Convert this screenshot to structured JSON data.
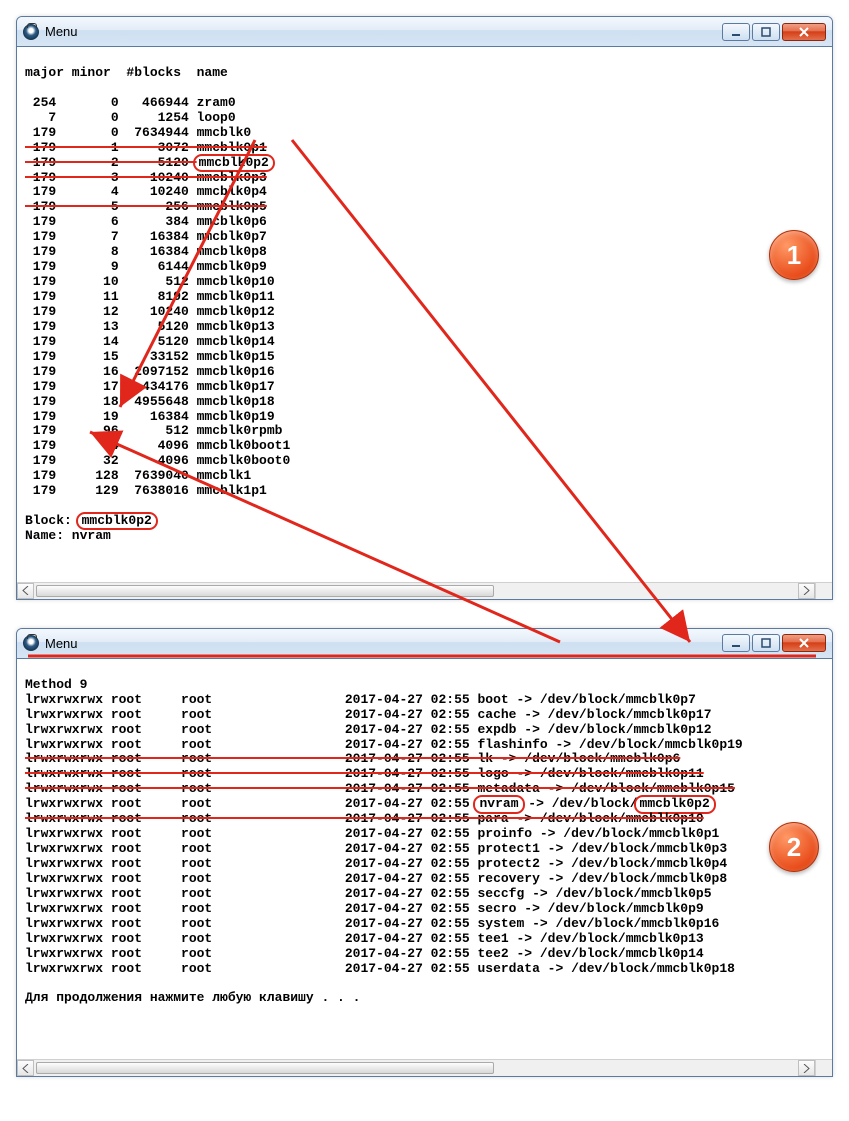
{
  "window1": {
    "title": "Menu",
    "header": "major minor  #blocks  name",
    "rows": [
      {
        "major": "254",
        "minor": "0",
        "blocks": "466944",
        "name": "zram0"
      },
      {
        "major": "7",
        "minor": "0",
        "blocks": "1254",
        "name": "loop0"
      },
      {
        "major": "179",
        "minor": "0",
        "blocks": "7634944",
        "name": "mmcblk0"
      },
      {
        "major": "179",
        "minor": "1",
        "blocks": "3072",
        "name": "mmcblk0p1",
        "strike": true
      },
      {
        "major": "179",
        "minor": "2",
        "blocks": "5120",
        "name": "mmcblk0p2",
        "highlight": true,
        "strike_prefix": true
      },
      {
        "major": "179",
        "minor": "3",
        "blocks": "10240",
        "name": "mmcblk0p3",
        "strike": true
      },
      {
        "major": "179",
        "minor": "4",
        "blocks": "10240",
        "name": "mmcblk0p4"
      },
      {
        "major": "179",
        "minor": "5",
        "blocks": "256",
        "name": "mmcblk0p5",
        "strike": true
      },
      {
        "major": "179",
        "minor": "6",
        "blocks": "384",
        "name": "mmcblk0p6"
      },
      {
        "major": "179",
        "minor": "7",
        "blocks": "16384",
        "name": "mmcblk0p7"
      },
      {
        "major": "179",
        "minor": "8",
        "blocks": "16384",
        "name": "mmcblk0p8"
      },
      {
        "major": "179",
        "minor": "9",
        "blocks": "6144",
        "name": "mmcblk0p9"
      },
      {
        "major": "179",
        "minor": "10",
        "blocks": "512",
        "name": "mmcblk0p10"
      },
      {
        "major": "179",
        "minor": "11",
        "blocks": "8192",
        "name": "mmcblk0p11"
      },
      {
        "major": "179",
        "minor": "12",
        "blocks": "10240",
        "name": "mmcblk0p12"
      },
      {
        "major": "179",
        "minor": "13",
        "blocks": "5120",
        "name": "mmcblk0p13"
      },
      {
        "major": "179",
        "minor": "14",
        "blocks": "5120",
        "name": "mmcblk0p14"
      },
      {
        "major": "179",
        "minor": "15",
        "blocks": "33152",
        "name": "mmcblk0p15"
      },
      {
        "major": "179",
        "minor": "16",
        "blocks": "2097152",
        "name": "mmcblk0p16"
      },
      {
        "major": "179",
        "minor": "17",
        "blocks": "434176",
        "name": "mmcblk0p17"
      },
      {
        "major": "179",
        "minor": "18",
        "blocks": "4955648",
        "name": "mmcblk0p18"
      },
      {
        "major": "179",
        "minor": "19",
        "blocks": "16384",
        "name": "mmcblk0p19"
      },
      {
        "major": "179",
        "minor": "96",
        "blocks": "512",
        "name": "mmcblk0rpmb"
      },
      {
        "major": "179",
        "minor": "64",
        "blocks": "4096",
        "name": "mmcblk0boot1"
      },
      {
        "major": "179",
        "minor": "32",
        "blocks": "4096",
        "name": "mmcblk0boot0"
      },
      {
        "major": "179",
        "minor": "128",
        "blocks": "7639040",
        "name": "mmcblk1"
      },
      {
        "major": "179",
        "minor": "129",
        "blocks": "7638016",
        "name": "mmcblk1p1"
      }
    ],
    "block_label": "Block:",
    "block_value": "mmcblk0p2",
    "name_label": "Name: nvram"
  },
  "window2": {
    "title": "Menu",
    "method": "Method 9",
    "listing": [
      {
        "perm": "lrwxrwxrwx",
        "u": "root",
        "g": "root",
        "date": "2017-04-27 02:55",
        "name": "boot",
        "target": "/dev/block/mmcblk0p7"
      },
      {
        "perm": "lrwxrwxrwx",
        "u": "root",
        "g": "root",
        "date": "2017-04-27 02:55",
        "name": "cache",
        "target": "/dev/block/mmcblk0p17"
      },
      {
        "perm": "lrwxrwxrwx",
        "u": "root",
        "g": "root",
        "date": "2017-04-27 02:55",
        "name": "expdb",
        "target": "/dev/block/mmcblk0p12"
      },
      {
        "perm": "lrwxrwxrwx",
        "u": "root",
        "g": "root",
        "date": "2017-04-27 02:55",
        "name": "flashinfo",
        "target": "/dev/block/mmcblk0p19"
      },
      {
        "perm": "lrwxrwxrwx",
        "u": "root",
        "g": "root",
        "date": "2017-04-27 02:55",
        "name": "lk",
        "target": "/dev/block/mmcblk0p6",
        "strike": true
      },
      {
        "perm": "lrwxrwxrwx",
        "u": "root",
        "g": "root",
        "date": "2017-04-27 02:55",
        "name": "logo",
        "target": "/dev/block/mmcblk0p11",
        "strike": true
      },
      {
        "perm": "lrwxrwxrwx",
        "u": "root",
        "g": "root",
        "date": "2017-04-27 02:55",
        "name": "metadata",
        "target": "/dev/block/mmcblk0p15",
        "strike": true
      },
      {
        "perm": "lrwxrwxrwx",
        "u": "root",
        "g": "root",
        "date": "2017-04-27 02:55",
        "name": "nvram",
        "target": "/dev/block/",
        "target2": "mmcblk0p2",
        "pill": true
      },
      {
        "perm": "lrwxrwxrwx",
        "u": "root",
        "g": "root",
        "date": "2017-04-27 02:55",
        "name": "para",
        "target": "/dev/block/mmcblk0p10",
        "strike": true
      },
      {
        "perm": "lrwxrwxrwx",
        "u": "root",
        "g": "root",
        "date": "2017-04-27 02:55",
        "name": "proinfo",
        "target": "/dev/block/mmcblk0p1"
      },
      {
        "perm": "lrwxrwxrwx",
        "u": "root",
        "g": "root",
        "date": "2017-04-27 02:55",
        "name": "protect1",
        "target": "/dev/block/mmcblk0p3"
      },
      {
        "perm": "lrwxrwxrwx",
        "u": "root",
        "g": "root",
        "date": "2017-04-27 02:55",
        "name": "protect2",
        "target": "/dev/block/mmcblk0p4"
      },
      {
        "perm": "lrwxrwxrwx",
        "u": "root",
        "g": "root",
        "date": "2017-04-27 02:55",
        "name": "recovery",
        "target": "/dev/block/mmcblk0p8"
      },
      {
        "perm": "lrwxrwxrwx",
        "u": "root",
        "g": "root",
        "date": "2017-04-27 02:55",
        "name": "seccfg",
        "target": "/dev/block/mmcblk0p5"
      },
      {
        "perm": "lrwxrwxrwx",
        "u": "root",
        "g": "root",
        "date": "2017-04-27 02:55",
        "name": "secro",
        "target": "/dev/block/mmcblk0p9"
      },
      {
        "perm": "lrwxrwxrwx",
        "u": "root",
        "g": "root",
        "date": "2017-04-27 02:55",
        "name": "system",
        "target": "/dev/block/mmcblk0p16"
      },
      {
        "perm": "lrwxrwxrwx",
        "u": "root",
        "g": "root",
        "date": "2017-04-27 02:55",
        "name": "tee1",
        "target": "/dev/block/mmcblk0p13"
      },
      {
        "perm": "lrwxrwxrwx",
        "u": "root",
        "g": "root",
        "date": "2017-04-27 02:55",
        "name": "tee2",
        "target": "/dev/block/mmcblk0p14"
      },
      {
        "perm": "lrwxrwxrwx",
        "u": "root",
        "g": "root",
        "date": "2017-04-27 02:55",
        "name": "userdata",
        "target": "/dev/block/mmcblk0p18"
      }
    ],
    "continue_prompt": "Для продолжения нажмите любую клавишу . . ."
  },
  "badges": {
    "one": "1",
    "two": "2"
  },
  "colors": {
    "accent_red": "#e1261c",
    "badge_fill": "#e84c1a"
  }
}
